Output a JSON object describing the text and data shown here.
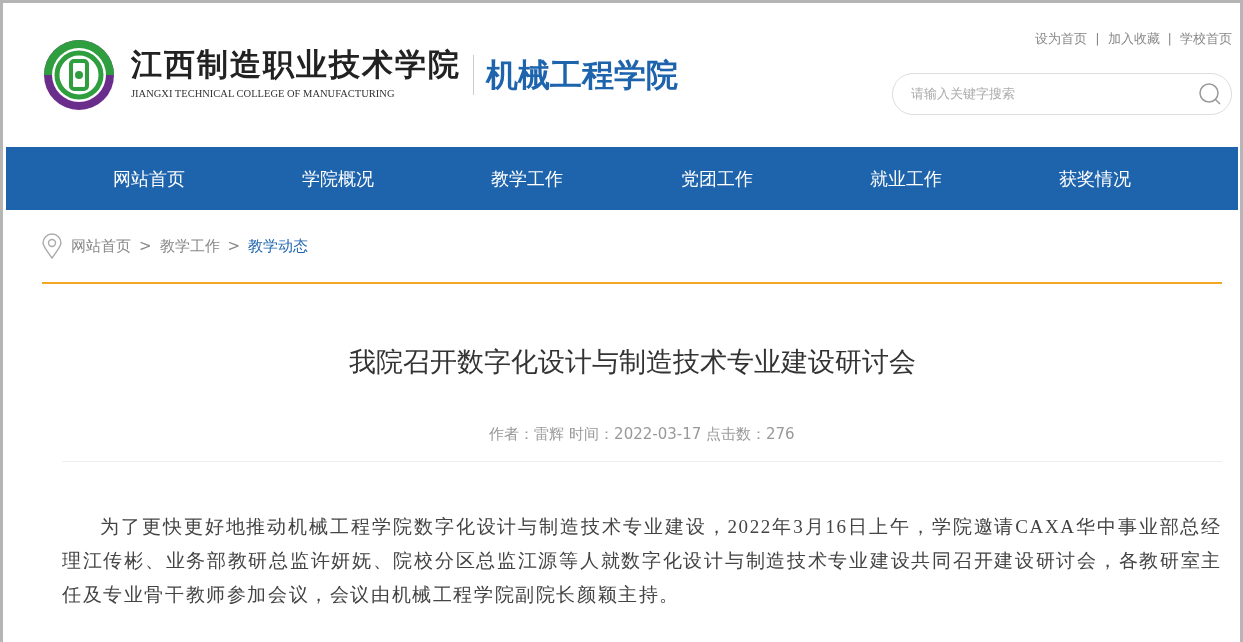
{
  "header": {
    "school_name_cn": "江西制造职业技术学院",
    "school_name_en": "JIANGXI TECHNICAL COLLEGE OF MANUFACTURING",
    "department": "机械工程学院",
    "top_links": [
      "设为首页",
      "加入收藏",
      "学校首页"
    ],
    "separator": "|",
    "search": {
      "placeholder": "请输入关键字搜索"
    }
  },
  "nav": [
    {
      "label": "网站首页"
    },
    {
      "label": "学院概况"
    },
    {
      "label": "教学工作"
    },
    {
      "label": "党团工作"
    },
    {
      "label": "就业工作"
    },
    {
      "label": "获奖情况"
    }
  ],
  "breadcrumb": [
    {
      "label": "网站首页",
      "current": false
    },
    {
      "label": "教学工作",
      "current": false
    },
    {
      "label": "教学动态",
      "current": true
    }
  ],
  "breadcrumb_separator": ">",
  "article": {
    "title": "我院召开数字化设计与制造技术专业建设研讨会",
    "meta": "作者：雷辉 时间：2022-03-17 点击数：276",
    "paragraph": "为了更快更好地推动机械工程学院数字化设计与制造技术专业建设，2022年3月16日上午，学院邀请CAXA华中事业部总经理江传彬、业务部教研总监许妍妩、院校分区总监江源等人就数字化设计与制造技术专业建设共同召开建设研讨会，各教研室主任及专业骨干教师参加会议，会议由机械工程学院副院长颜颖主持。"
  }
}
